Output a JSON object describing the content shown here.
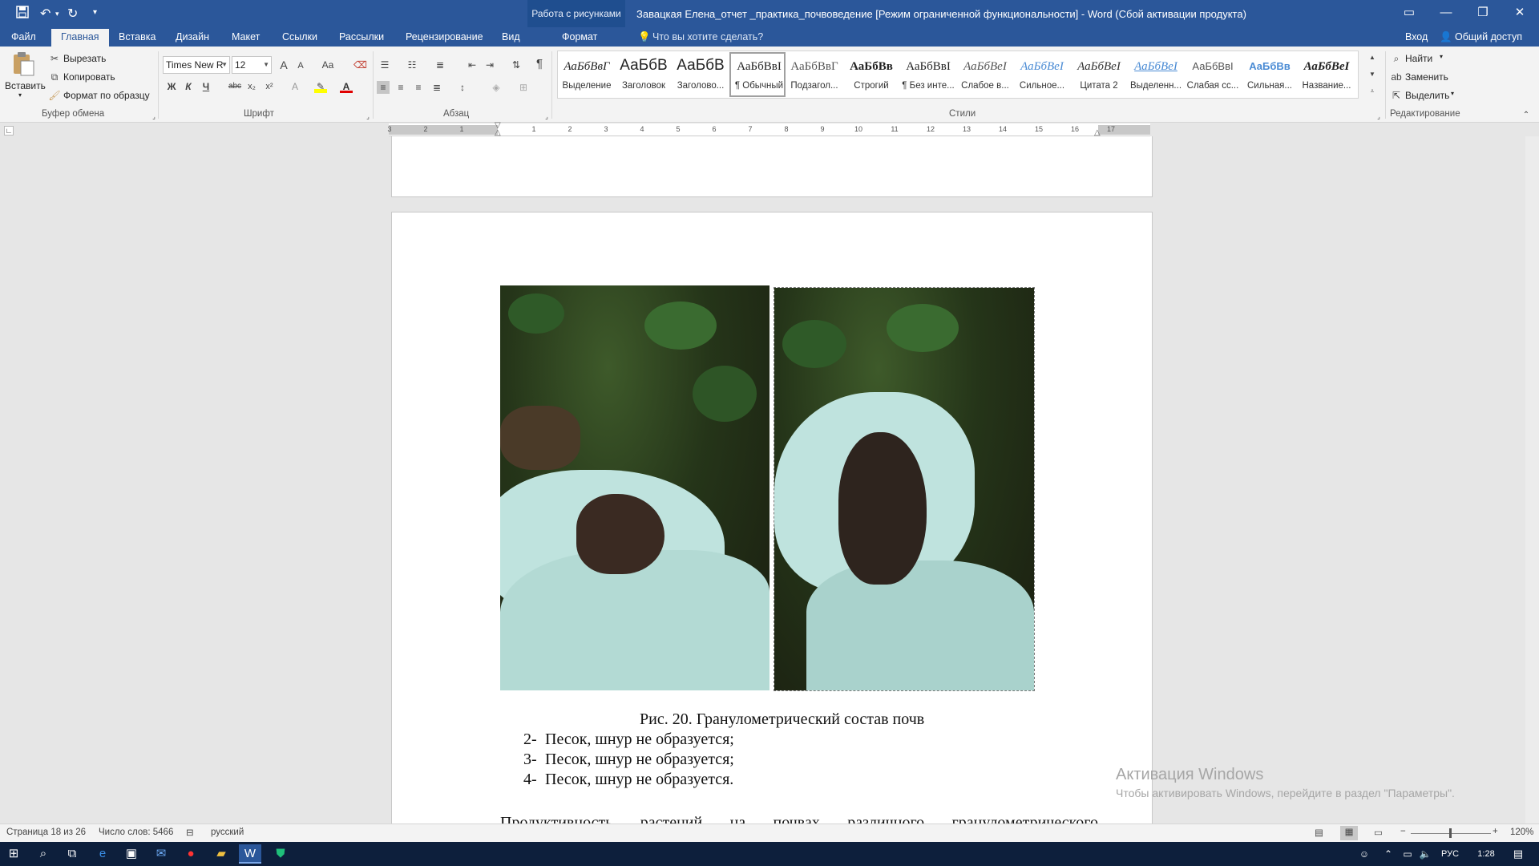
{
  "window": {
    "title": "Завацкая Елена_отчет _практика_почвоведение [Режим ограниченной функциональности] - Word (Сбой активации продукта)",
    "context_group": "Работа с рисунками",
    "context_tab": "Формат"
  },
  "quick_access": {
    "save": "save-icon",
    "undo": "undo-icon",
    "redo": "redo-icon"
  },
  "tabs": [
    "Файл",
    "Главная",
    "Вставка",
    "Дизайн",
    "Макет",
    "Ссылки",
    "Рассылки",
    "Рецензирование",
    "Вид"
  ],
  "tell_me": "Что вы хотите сделать?",
  "signin": "Вход",
  "share": "Общий доступ",
  "clipboard": {
    "paste": "Вставить",
    "cut": "Вырезать",
    "copy": "Копировать",
    "format_painter": "Формат по образцу",
    "group": "Буфер обмена"
  },
  "font": {
    "name": "Times New R",
    "size": "12",
    "group": "Шрифт",
    "bold": "Ж",
    "italic": "К",
    "underline": "Ч",
    "strike": "abc",
    "subscript": "x₂",
    "superscript": "x²",
    "change_case": "Aa",
    "grow": "A",
    "shrink": "A",
    "font_color": "A"
  },
  "paragraph": {
    "group": "Абзац",
    "show_marks": "¶"
  },
  "styles": {
    "group": "Стили",
    "items": [
      {
        "preview": "АаБбВвГ",
        "name": "Выделение"
      },
      {
        "preview": "АаБбВ",
        "name": "Заголовок"
      },
      {
        "preview": "АаБбВ",
        "name": "Заголово..."
      },
      {
        "preview": "АаБбВвI",
        "name": "¶ Обычный"
      },
      {
        "preview": "АаБбВвГ",
        "name": "Подзагол..."
      },
      {
        "preview": "АаБбВв",
        "name": "Строгий"
      },
      {
        "preview": "АаБбВвI",
        "name": "¶ Без инте..."
      },
      {
        "preview": "АаБбВеI",
        "name": "Слабое в..."
      },
      {
        "preview": "АаБбВеI",
        "name": "Сильное..."
      },
      {
        "preview": "АаБбВеI",
        "name": "Цитата 2"
      },
      {
        "preview": "АаБбВеI",
        "name": "Выделенн..."
      },
      {
        "preview": "АаБбВвI",
        "name": "Слабая сс..."
      },
      {
        "preview": "АаБбВв",
        "name": "Сильная..."
      },
      {
        "preview": "АаБбВеI",
        "name": "Название..."
      }
    ]
  },
  "editing": {
    "group": "Редактирование",
    "find": "Найти",
    "replace": "Заменить",
    "select": "Выделить"
  },
  "ruler": {
    "ticks": [
      "3",
      "2",
      "1",
      "1",
      "2",
      "3",
      "4",
      "5",
      "6",
      "7",
      "8",
      "9",
      "10",
      "11",
      "12",
      "13",
      "14",
      "15",
      "16",
      "17"
    ]
  },
  "document": {
    "caption": "Рис. 20. Гранулометрический состав почв",
    "list": [
      {
        "num": "2-",
        "text": "Песок, шнур не образуется;"
      },
      {
        "num": "3-",
        "text": "Песок, шнур не образуется;"
      },
      {
        "num": "4-",
        "text": "Песок, шнур не образуется."
      }
    ],
    "paragraph_start": "Продуктивность растений на почвах различного гранулометрического"
  },
  "activation": {
    "title": "Активация Windows",
    "subtitle": "Чтобы активировать Windows, перейдите в раздел \"Параметры\"."
  },
  "status": {
    "page": "Страница 18 из 26",
    "words": "Число слов: 5466",
    "language": "русский",
    "zoom": "120%"
  },
  "taskbar": {
    "lang": "РУС",
    "time": "1:28"
  }
}
